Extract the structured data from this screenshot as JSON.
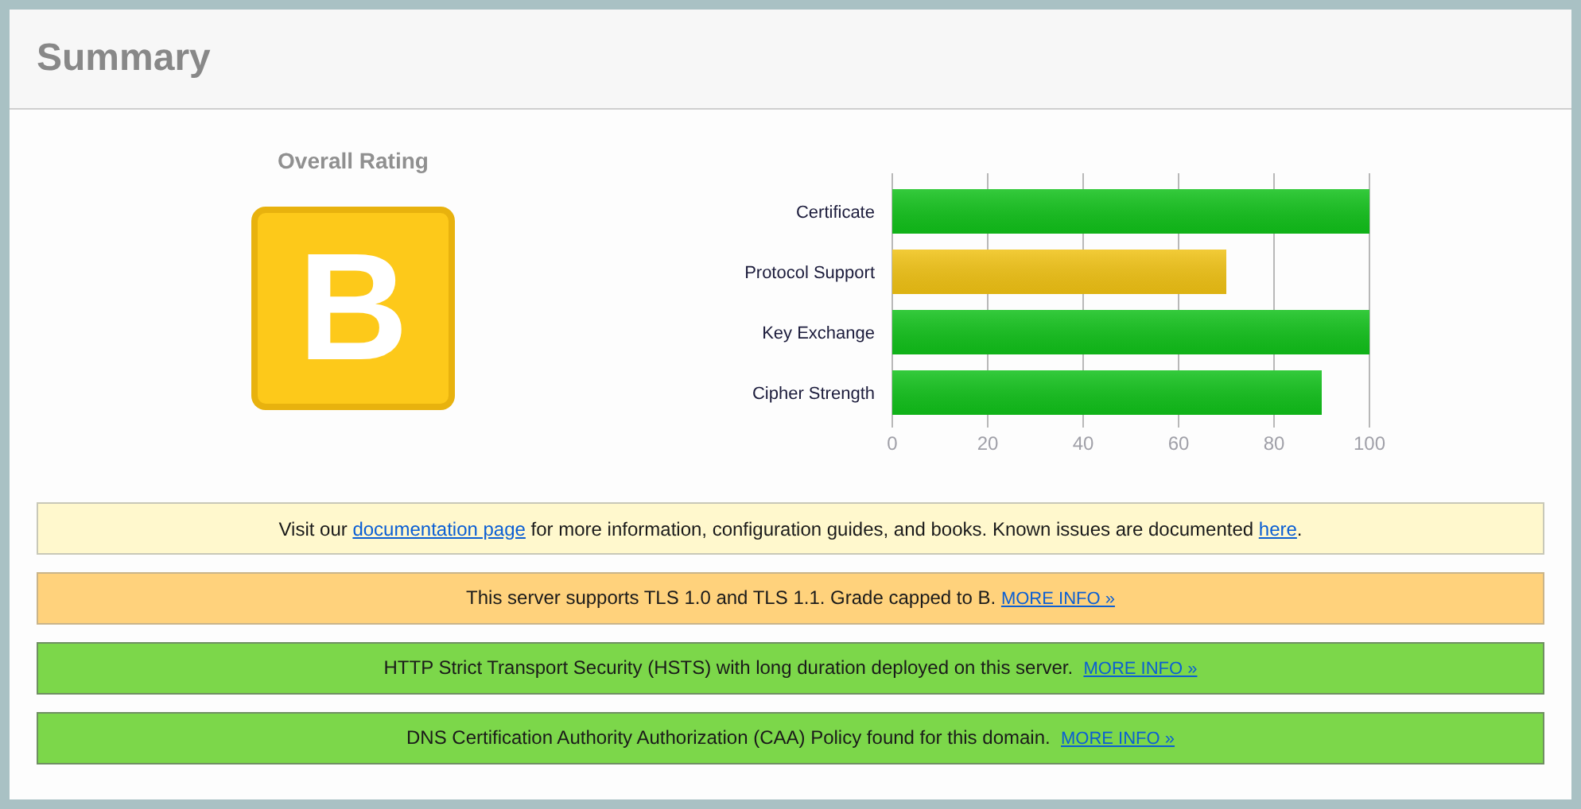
{
  "title": "Summary",
  "rating": {
    "label": "Overall Rating",
    "grade": "B",
    "color": "#fdc91a"
  },
  "chart_data": {
    "type": "bar",
    "orientation": "horizontal",
    "stacked": true,
    "grid": true,
    "categories": [
      "Certificate",
      "Protocol Support",
      "Key Exchange",
      "Cipher Strength"
    ],
    "series": [
      {
        "color": "#11c11a",
        "values": [
          100,
          null,
          100,
          90
        ]
      },
      {
        "color": "#f0c214",
        "values": [
          null,
          70,
          null,
          null
        ]
      }
    ],
    "xlim": [
      0,
      100
    ],
    "xticks": [
      0,
      20,
      40,
      60,
      80,
      100
    ]
  },
  "messages": [
    {
      "kind": "info",
      "parts": [
        {
          "kind": "text",
          "text": "Visit our "
        },
        {
          "kind": "link",
          "text": "documentation page"
        },
        {
          "kind": "text",
          "text": " for more information, configuration guides, and books. Known issues are documented "
        },
        {
          "kind": "link",
          "text": "here"
        },
        {
          "kind": "text",
          "text": "."
        }
      ]
    },
    {
      "kind": "warning",
      "parts": [
        {
          "kind": "text",
          "text": "This server supports TLS 1.0 and TLS 1.1. Grade capped to B. "
        },
        {
          "kind": "more_link",
          "text": "MORE INFO »"
        }
      ]
    },
    {
      "kind": "good",
      "parts": [
        {
          "kind": "text",
          "text": "HTTP Strict Transport Security (HSTS) with long duration deployed on this server.  "
        },
        {
          "kind": "more_link",
          "text": "MORE INFO »"
        }
      ]
    },
    {
      "kind": "good",
      "parts": [
        {
          "kind": "text",
          "text": "DNS Certification Authority Authorization (CAA) Policy found for this domain.  "
        },
        {
          "kind": "more_link",
          "text": "MORE INFO »"
        }
      ]
    }
  ]
}
